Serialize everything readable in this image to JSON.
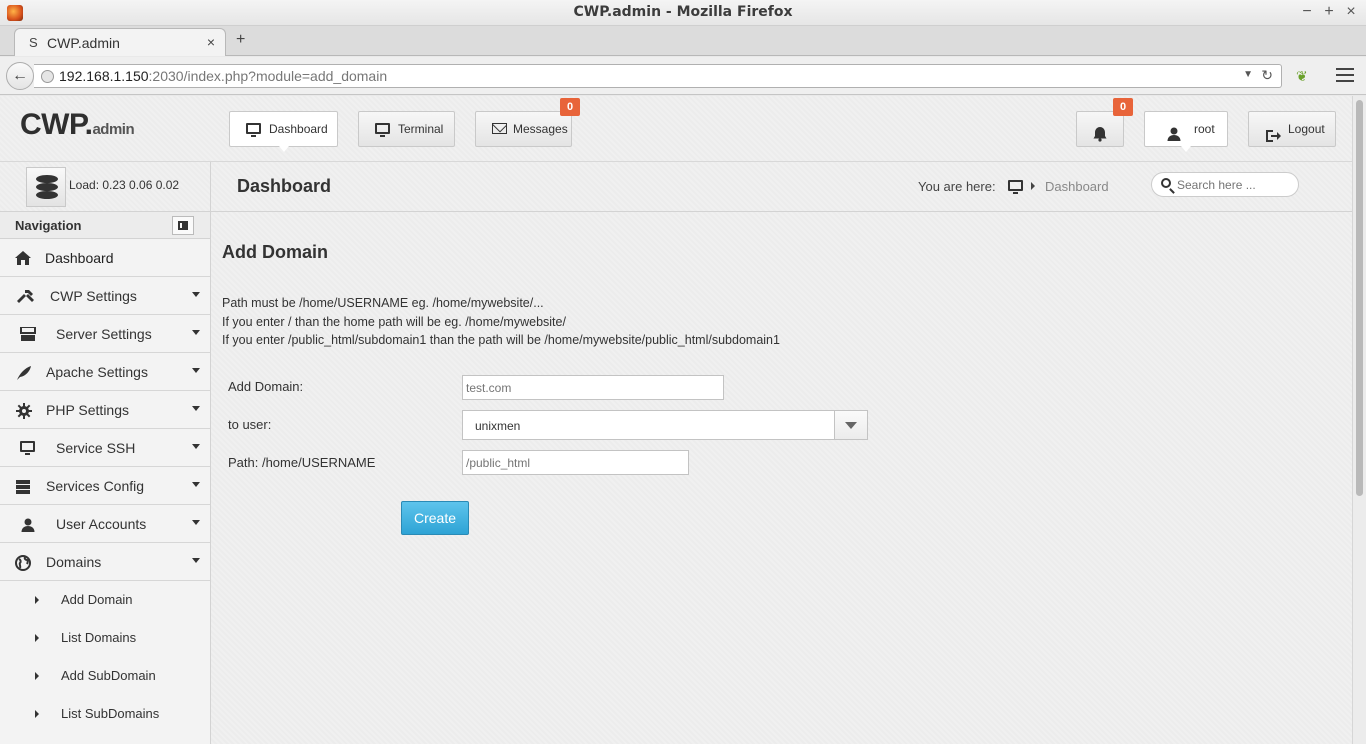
{
  "window": {
    "title": "CWP.admin - Mozilla Firefox",
    "controls": {
      "minimize": "−",
      "maximize": "+",
      "close": "×"
    }
  },
  "browser": {
    "tab": {
      "favicon": "S",
      "title": "CWP.admin",
      "close": "×"
    },
    "new_tab": "+",
    "url": {
      "host": "192.168.1.150",
      "rest": ":2030/index.php?module=add_domain"
    }
  },
  "header": {
    "logo": {
      "main": "CWP.",
      "sub": "admin"
    },
    "buttons": {
      "dashboard": "Dashboard",
      "terminal": "Terminal",
      "messages": "Messages",
      "messages_badge": "0",
      "notifications_badge": "0",
      "user": "root",
      "logout": "Logout"
    }
  },
  "status": {
    "load": "Load: 0.23  0.06  0.02"
  },
  "titlebar": {
    "page_title": "Dashboard",
    "breadcrumb_label": "You are here:",
    "breadcrumb_current": "Dashboard",
    "search_placeholder": "Search here ..."
  },
  "sidebar": {
    "heading": "Navigation",
    "items": [
      {
        "label": "Dashboard",
        "icon": "home-icon"
      },
      {
        "label": "CWP Settings",
        "icon": "tools-icon"
      },
      {
        "label": "Server Settings",
        "icon": "server-icon"
      },
      {
        "label": "Apache Settings",
        "icon": "feather-icon"
      },
      {
        "label": "PHP Settings",
        "icon": "gear-icon"
      },
      {
        "label": "Service SSH",
        "icon": "monitor-icon"
      },
      {
        "label": "Services Config",
        "icon": "stack-icon"
      },
      {
        "label": "User Accounts",
        "icon": "user-icon"
      },
      {
        "label": "Domains",
        "icon": "globe-icon"
      }
    ],
    "domain_subitems": [
      "Add Domain",
      "List Domains",
      "Add SubDomain",
      "List SubDomains"
    ]
  },
  "form": {
    "heading": "Add Domain",
    "info": [
      "Path must be /home/USERNAME eg. /home/mywebsite/...",
      "If you enter / than the home path will be eg. /home/mywebsite/",
      "If you enter /public_html/subdomain1 than the path will be /home/mywebsite/public_html/subdomain1"
    ],
    "domain_label": "Add Domain:",
    "domain_placeholder": "test.com",
    "user_label": "to user:",
    "user_value": "unixmen",
    "path_label": "Path: /home/USERNAME",
    "path_placeholder": "/public_html",
    "submit": "Create"
  },
  "colors": {
    "accent": "#2ea3d5",
    "badge": "#e8643a"
  }
}
